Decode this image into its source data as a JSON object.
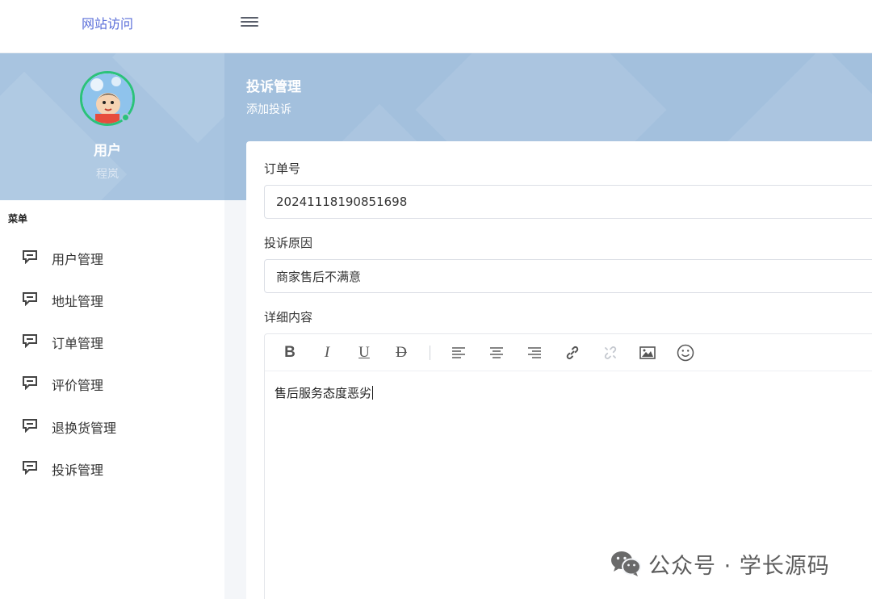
{
  "topbar": {
    "site_link": "网站访问"
  },
  "profile": {
    "role": "用户",
    "name": "程岚"
  },
  "page": {
    "title": "投诉管理",
    "subtitle": "添加投诉"
  },
  "sidebar": {
    "heading": "菜单",
    "items": [
      {
        "label": "用户管理",
        "icon": "comment-icon"
      },
      {
        "label": "地址管理",
        "icon": "comment-icon"
      },
      {
        "label": "订单管理",
        "icon": "comment-icon"
      },
      {
        "label": "评价管理",
        "icon": "comment-icon"
      },
      {
        "label": "退换货管理",
        "icon": "comment-icon"
      },
      {
        "label": "投诉管理",
        "icon": "comment-icon"
      }
    ]
  },
  "form": {
    "order_no": {
      "label": "订单号",
      "value": "20241118190851698"
    },
    "reason": {
      "label": "投诉原因",
      "value": "商家售后不满意"
    },
    "detail": {
      "label": "详细内容",
      "content": "售后服务态度恶劣"
    }
  },
  "toolbar": {
    "bold": "B",
    "italic": "I",
    "underline": "U",
    "strike": "D"
  },
  "watermark": {
    "text": "公众号 · 学长源码"
  },
  "colors": {
    "accent": "#5b6fd9",
    "banner": "#a3c0dd",
    "online": "#2bc27a"
  }
}
